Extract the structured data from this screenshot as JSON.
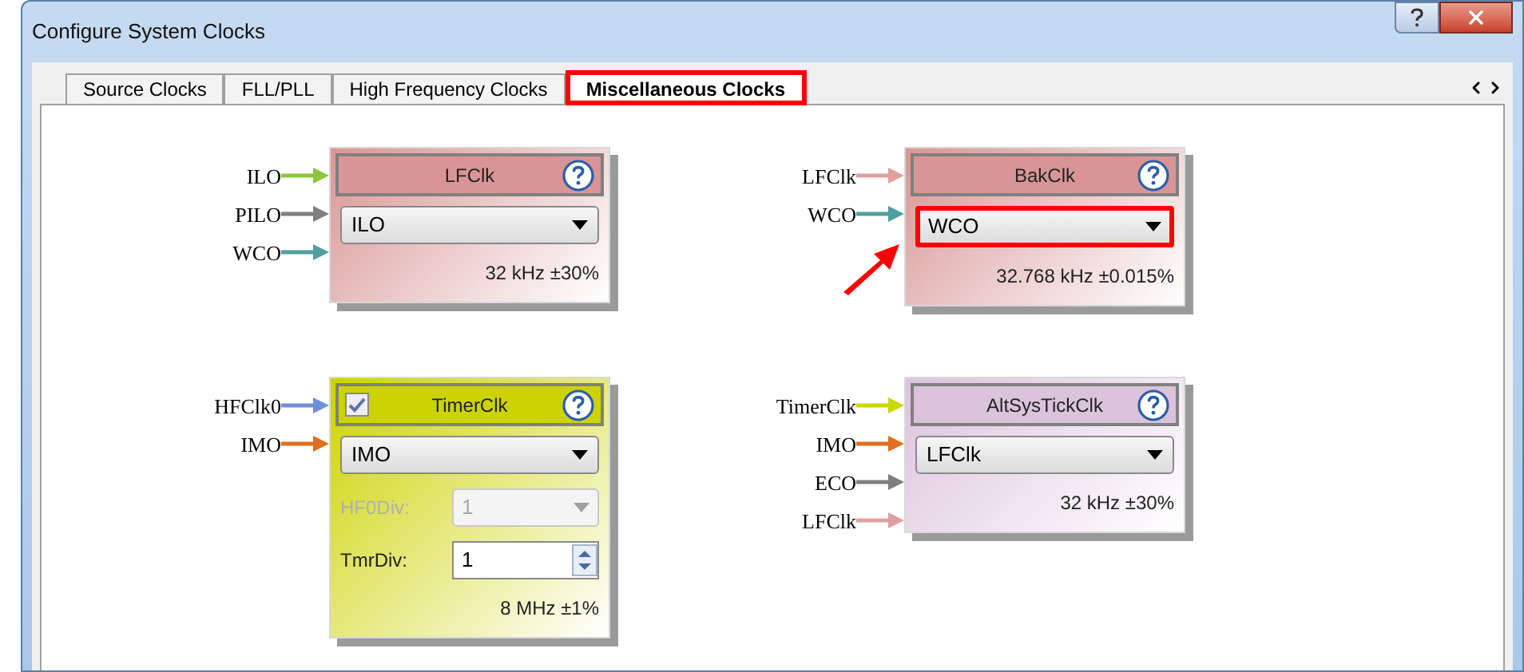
{
  "window": {
    "title": "Configure System Clocks"
  },
  "tabs": [
    {
      "label": "Source Clocks",
      "selected": false,
      "highlighted": false
    },
    {
      "label": "FLL/PLL",
      "selected": false,
      "highlighted": false
    },
    {
      "label": "High Frequency Clocks",
      "selected": false,
      "highlighted": false
    },
    {
      "label": "Miscellaneous Clocks",
      "selected": true,
      "highlighted": true
    }
  ],
  "blocks": [
    {
      "title": "LFClk",
      "color": "#d99595",
      "inputs": [
        {
          "label": "ILO",
          "color": "#8cc63f"
        },
        {
          "label": "PILO",
          "color": "#7f7f7f"
        },
        {
          "label": "WCO",
          "color": "#4f9fa0"
        }
      ],
      "select": {
        "value": "ILO",
        "highlighted": false
      },
      "frequency": "32 kHz ±30%"
    },
    {
      "title": "BakClk",
      "color": "#d99595",
      "inputs": [
        {
          "label": "LFClk",
          "color": "#e0a0a0"
        },
        {
          "label": "WCO",
          "color": "#4f9fa0"
        }
      ],
      "select": {
        "value": "WCO",
        "highlighted": true
      },
      "frequency": "32.768 kHz ±0.015%"
    },
    {
      "title": "TimerClk",
      "color": "#cdd300",
      "checked": true,
      "inputs": [
        {
          "label": "HFClk0",
          "color": "#6f8fd8"
        },
        {
          "label": "IMO",
          "color": "#e07020"
        }
      ],
      "select": {
        "value": "IMO",
        "highlighted": false
      },
      "fields": [
        {
          "kind": "select",
          "label": "HF0Div:",
          "value": "1",
          "disabled": true
        },
        {
          "kind": "spin",
          "label": "TmrDiv:",
          "value": "1",
          "disabled": false
        }
      ],
      "frequency": "8 MHz ±1%"
    },
    {
      "title": "AltSysTickClk",
      "color": "#dcc3dc",
      "inputs": [
        {
          "label": "TimerClk",
          "color": "#c8d800"
        },
        {
          "label": "IMO",
          "color": "#e07020"
        },
        {
          "label": "ECO",
          "color": "#7f7f7f"
        },
        {
          "label": "LFClk",
          "color": "#e0a0a0"
        }
      ],
      "select": {
        "value": "LFClk",
        "highlighted": false
      },
      "frequency": "32 kHz ±30%"
    }
  ]
}
